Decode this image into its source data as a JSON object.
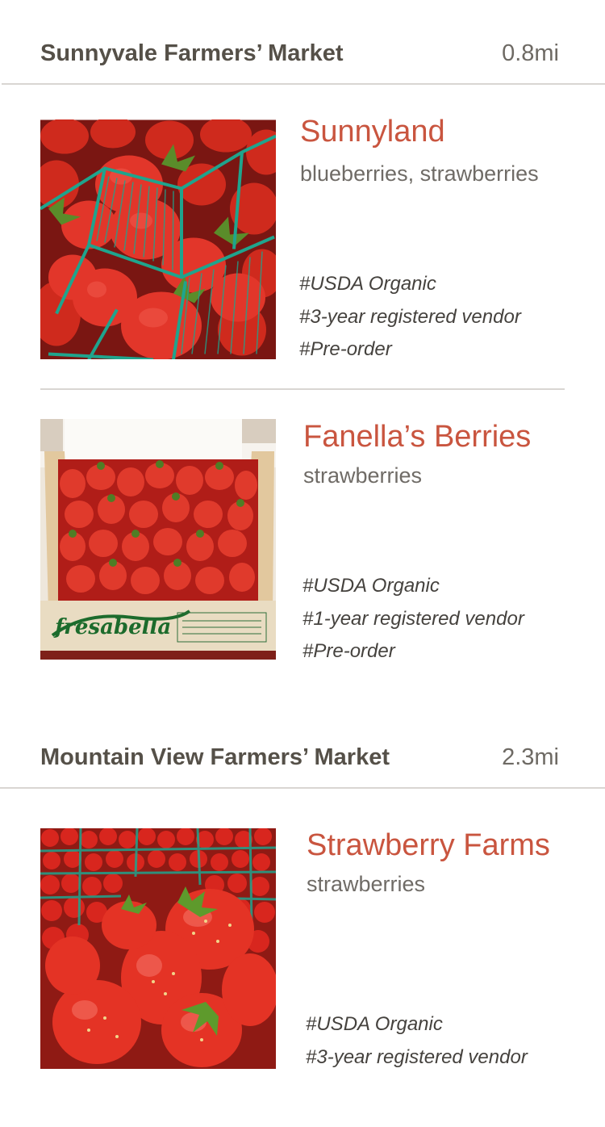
{
  "markets": [
    {
      "name": "Sunnyvale Farmers’ Market",
      "distance": "0.8mi",
      "vendors": [
        {
          "name": "Sunnyland",
          "products": "blueberries, strawberries",
          "photo_icon": "strawberry-baskets-photo",
          "tags": [
            "#USDA Organic",
            "#3-year registered vendor",
            "#Pre-order"
          ]
        },
        {
          "name": "Fanella’s Berries",
          "products": "strawberries",
          "photo_icon": "strawberry-crate-photo",
          "crate_label": "fresabella",
          "tags": [
            "#USDA Organic",
            "#1-year registered vendor",
            "#Pre-order"
          ]
        }
      ]
    },
    {
      "name": "Mountain View Farmers’ Market",
      "distance": "2.3mi",
      "vendors": [
        {
          "name": "Strawberry Farms",
          "products": "strawberries",
          "photo_icon": "strawberry-closeup-photo",
          "tags": [
            "#USDA Organic",
            "#3-year registered vendor"
          ]
        }
      ]
    }
  ],
  "colors": {
    "vendor_name": "#c9553f",
    "market_name": "#555048",
    "divider": "#d9d6d2",
    "berry_red": "#d8261e",
    "basket_green": "#1fa48d"
  }
}
